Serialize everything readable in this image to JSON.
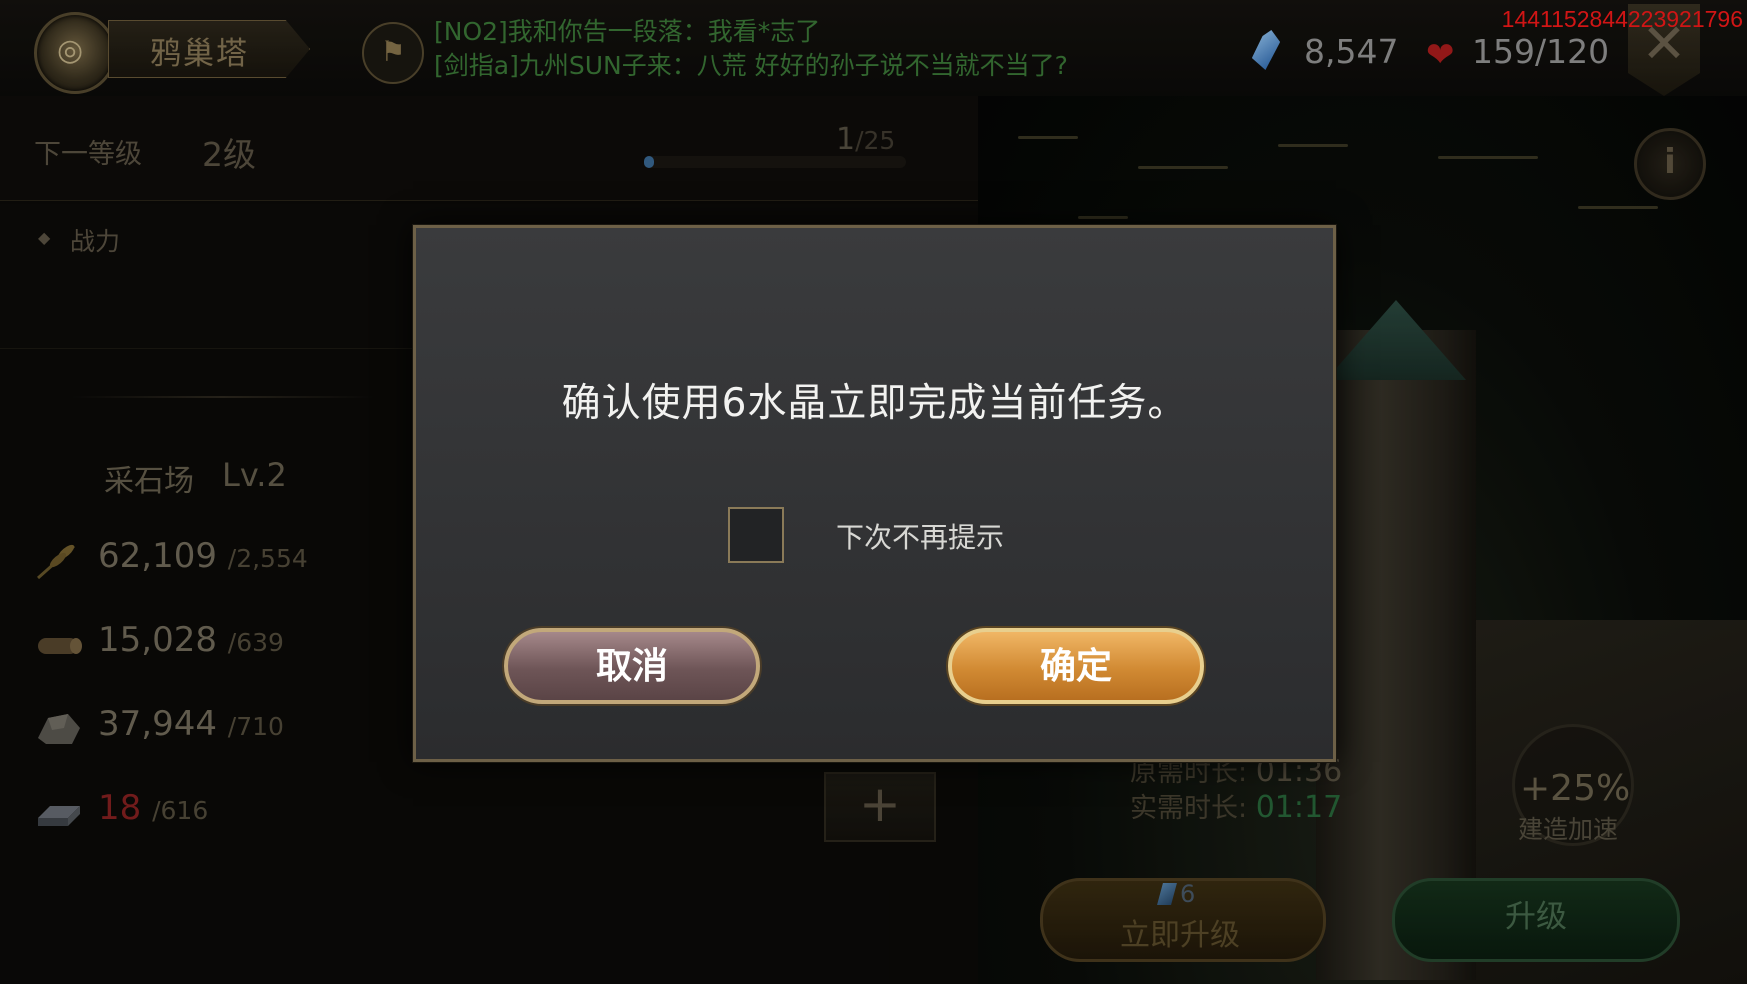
{
  "header": {
    "title": "鸦巢塔",
    "chat": [
      "[NO2]我和你告一段落：我看*志了",
      "[剑指a]九州SUN子来：八荒   好好的孙子说不当就不当了?"
    ],
    "crystals": "8,547",
    "stamina": "159/120",
    "close_glyph": "✕",
    "user_id": "1441152844223921796"
  },
  "level": {
    "next_label": "下一等级",
    "next_value": "2级",
    "progress_current": "1",
    "progress_total": "/25",
    "progress_fraction": 0.04
  },
  "power": {
    "label": "战力"
  },
  "building": {
    "name": "采石场",
    "level": "Lv.2"
  },
  "resources": [
    {
      "icon": "wheat-icon",
      "current": "62,109",
      "required": "/2,554",
      "insufficient": false
    },
    {
      "icon": "wood-icon",
      "current": "15,028",
      "required": "/639",
      "insufficient": false
    },
    {
      "icon": "stone-icon",
      "current": "37,944",
      "required": "/710",
      "insufficient": false
    },
    {
      "icon": "iron-icon",
      "current": "18",
      "required": "/616",
      "insufficient": true
    }
  ],
  "plus_glyph": "+",
  "time": {
    "orig_label": "原需时长:",
    "orig_value": "01:36",
    "real_label": "实需时长:",
    "real_value": "01:17"
  },
  "speed": {
    "pct": "+25%",
    "label": "建造加速"
  },
  "actions": {
    "instant_cost": "6",
    "instant_label": "立即升级",
    "upgrade_label": "升级"
  },
  "dialog": {
    "message": "确认使用6水晶立即完成当前任务。",
    "checkbox_label": "下次不再提示",
    "cancel": "取消",
    "confirm": "确定"
  },
  "colors": {
    "dialog_bg": "#323335",
    "confirm": "#d18a33",
    "cancel": "#6e5557",
    "user_id": "#ff1a1a"
  }
}
